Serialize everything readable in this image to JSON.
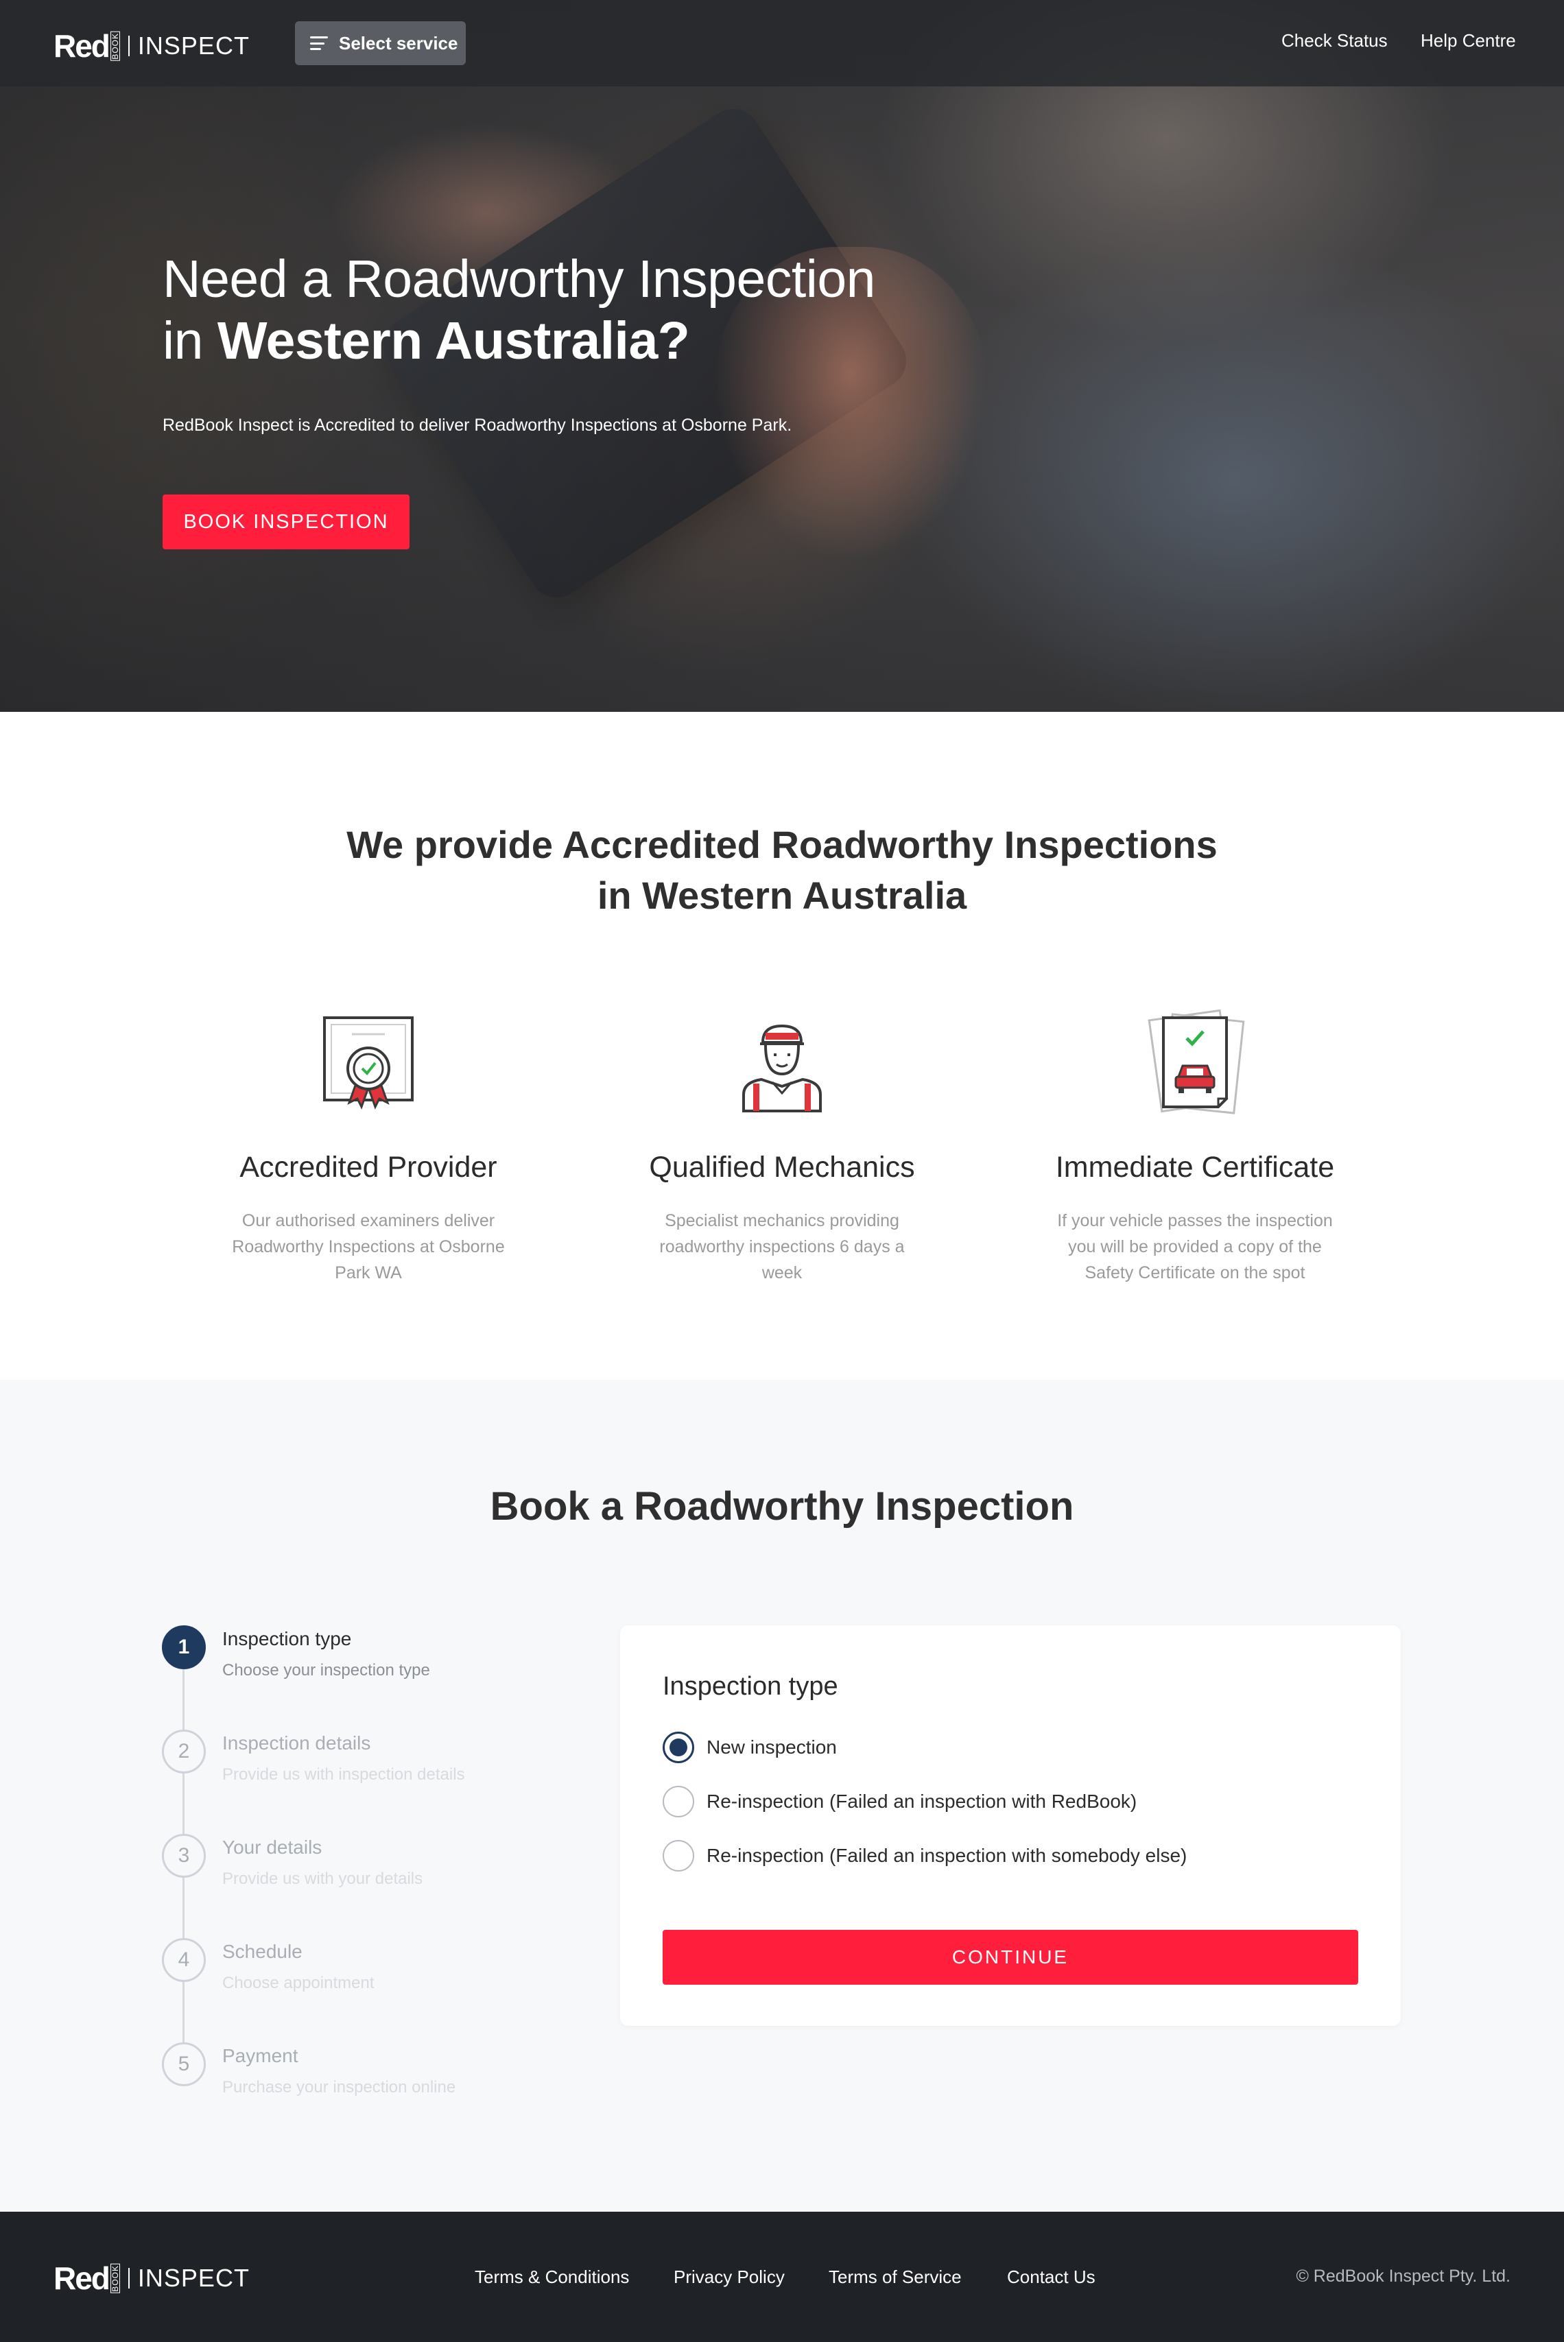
{
  "brand": {
    "logo_main": "Red",
    "logo_vertical": "BOOK",
    "logo_product": "INSPECT",
    "accent": "#ff1f3d",
    "navy": "#1e3a5f"
  },
  "header": {
    "select_service": "Select service",
    "nav": [
      "Check Status",
      "Help Centre"
    ]
  },
  "hero": {
    "title_line1": "Need a Roadworthy Inspection",
    "title_line2_prefix": "in ",
    "title_line2_bold": "Western Australia?",
    "subtitle": "RedBook Inspect is Accredited to deliver Roadworthy Inspections at Osborne Park.",
    "cta": "BOOK INSPECTION"
  },
  "features": {
    "title_line1": "We provide Accredited Roadworthy Inspections",
    "title_line2": "in Western Australia",
    "items": [
      {
        "icon": "certificate-badge-icon",
        "title": "Accredited Provider",
        "desc": "Our authorised examiners deliver Roadworthy Inspections at Osborne Park WA"
      },
      {
        "icon": "mechanic-icon",
        "title": "Qualified Mechanics",
        "desc": "Specialist mechanics providing roadworthy inspections 6 days a week"
      },
      {
        "icon": "car-document-check-icon",
        "title": "Immediate Certificate",
        "desc": "If your vehicle passes the inspection you will be provided a copy of the Safety Certificate on the spot"
      }
    ]
  },
  "booking": {
    "title": "Book a Roadworthy Inspection",
    "steps": [
      {
        "num": "1",
        "label": "Inspection type",
        "desc": "Choose your inspection type",
        "active": true
      },
      {
        "num": "2",
        "label": "Inspection details",
        "desc": "Provide us with inspection details",
        "active": false
      },
      {
        "num": "3",
        "label": "Your details",
        "desc": "Provide us with your details",
        "active": false
      },
      {
        "num": "4",
        "label": "Schedule",
        "desc": "Choose appointment",
        "active": false
      },
      {
        "num": "5",
        "label": "Payment",
        "desc": "Purchase your inspection online",
        "active": false
      }
    ],
    "card": {
      "title": "Inspection type",
      "options": [
        {
          "label": "New inspection",
          "selected": true
        },
        {
          "label": "Re-inspection (Failed an inspection with RedBook)",
          "selected": false
        },
        {
          "label": "Re-inspection (Failed an inspection with somebody else)",
          "selected": false
        }
      ],
      "continue": "CONTINUE"
    }
  },
  "footer": {
    "links": [
      "Terms & Conditions",
      "Privacy Policy",
      "Terms of Service",
      "Contact Us"
    ],
    "copyright": "© RedBook Inspect Pty. Ltd."
  }
}
